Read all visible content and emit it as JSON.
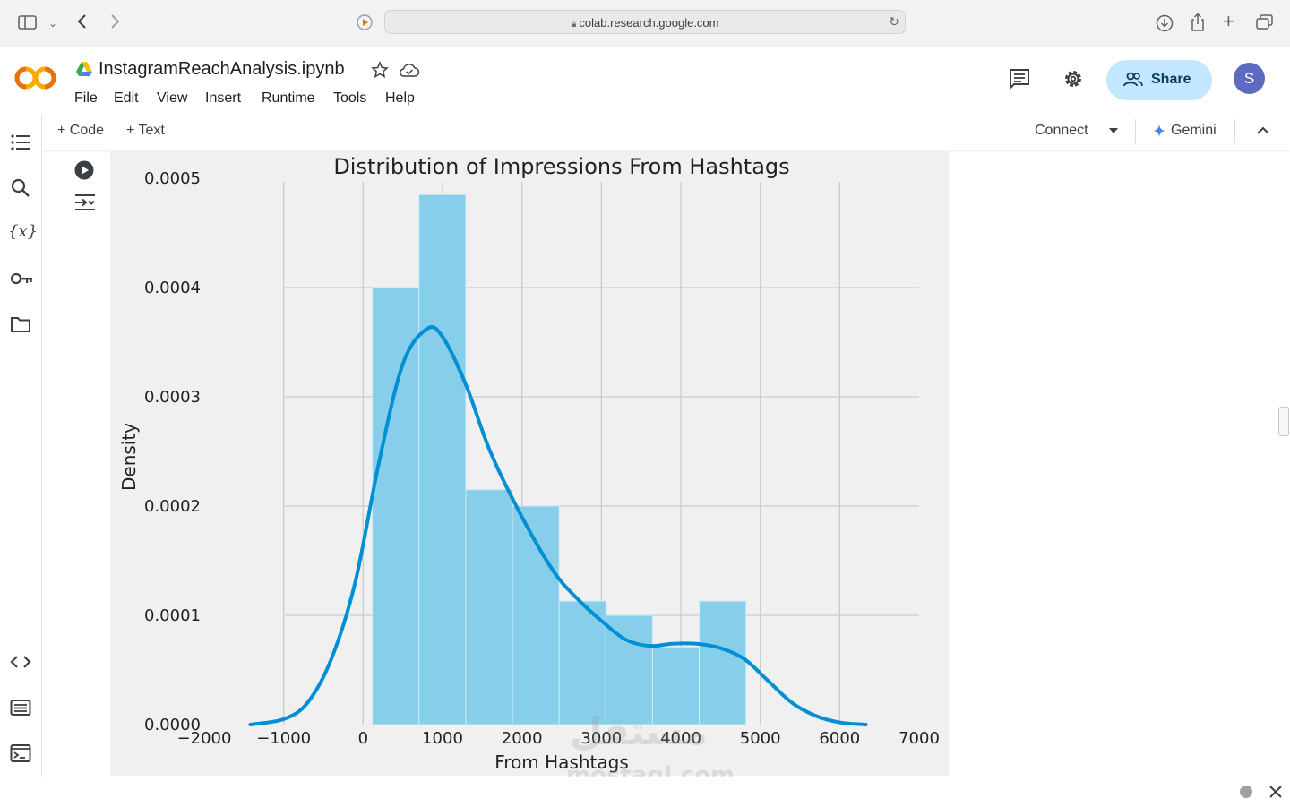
{
  "browser": {
    "url": "colab.research.google.com"
  },
  "notebook": {
    "title": "InstagramReachAnalysis.ipynb"
  },
  "menu": [
    "File",
    "Edit",
    "View",
    "Insert",
    "Runtime",
    "Tools",
    "Help"
  ],
  "header": {
    "share_label": "Share",
    "avatar_initial": "S"
  },
  "toolbar": {
    "add_code": "+ Code",
    "add_text": "+ Text",
    "connect": "Connect",
    "gemini": "Gemini"
  },
  "colors": {
    "bar": "#87ceeb",
    "kde": "#008fd5",
    "plot_bg": "#f0f0f0",
    "grid": "#cbcbcb",
    "share_bg": "#c2e7ff"
  },
  "chart_data": {
    "type": "bar",
    "title": "Distribution of Impressions From Hashtags",
    "xlabel": "From Hashtags",
    "ylabel": "Density",
    "xlim": [
      -2000,
      7000
    ],
    "ylim": [
      0,
      0.0005
    ],
    "x_ticks": [
      "−2000",
      "−1000",
      "0",
      "1000",
      "2000",
      "3000",
      "4000",
      "5000",
      "6000",
      "7000"
    ],
    "y_ticks": [
      "0.0000",
      "0.0001",
      "0.0002",
      "0.0003",
      "0.0004",
      "0.0005"
    ],
    "x_tick_values": [
      -2000,
      -1000,
      0,
      1000,
      2000,
      3000,
      4000,
      5000,
      6000,
      7000
    ],
    "y_tick_values": [
      0,
      0.0001,
      0.0002,
      0.0003,
      0.0004,
      0.0005
    ],
    "grid": true,
    "histogram": {
      "bin_edges": [
        116,
        704,
        1292,
        1880,
        2468,
        3056,
        3644,
        4232,
        4820
      ],
      "density": [
        0.0004,
        0.000485,
        0.000215,
        0.0002,
        0.000113,
        0.0001,
        7.1e-05,
        0.000113
      ]
    },
    "kde": {
      "x": [
        -1420,
        -1000,
        -700,
        -400,
        -100,
        200,
        500,
        800,
        1000,
        1300,
        1600,
        2000,
        2400,
        2700,
        3000,
        3300,
        3600,
        3900,
        4200,
        4500,
        4800,
        5100,
        5400,
        5700,
        6000,
        6330
      ],
      "y": [
        0.0,
        5e-06,
        2e-05,
        6e-05,
        0.00013,
        0.00024,
        0.00033,
        0.000362,
        0.000355,
        0.00031,
        0.00025,
        0.00019,
        0.00014,
        0.000115,
        9.5e-05,
        7.8e-05,
        7.2e-05,
        7.4e-05,
        7.4e-05,
        7e-05,
        6e-05,
        4e-05,
        2e-05,
        8e-06,
        2e-06,
        0.0
      ]
    }
  },
  "watermark": {
    "arabic": "مستقل",
    "latin": "mostaql.com"
  }
}
